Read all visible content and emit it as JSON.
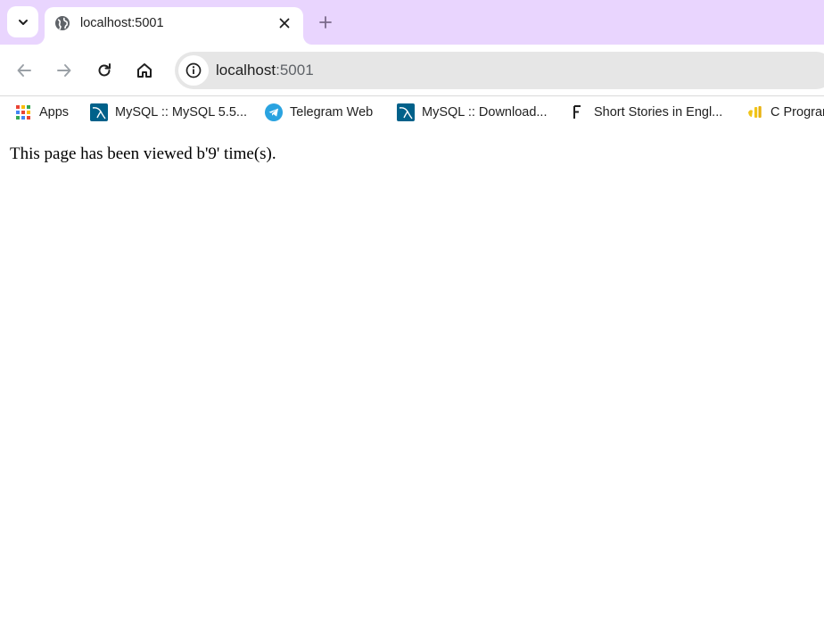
{
  "browser": {
    "tab": {
      "title": "localhost:5001"
    },
    "omnibox": {
      "host": "localhost",
      "port": ":5001"
    }
  },
  "bookmarks": [
    {
      "label": "Apps",
      "icon": "apps-grid-icon"
    },
    {
      "label": "MySQL :: MySQL 5.5...",
      "icon": "mysql-icon"
    },
    {
      "label": "Telegram Web",
      "icon": "telegram-icon"
    },
    {
      "label": "MySQL :: Download...",
      "icon": "mysql-icon"
    },
    {
      "label": "Short Stories in Engl...",
      "icon": "f-letter-icon"
    },
    {
      "label": "C Program",
      "icon": "js-logo-icon"
    }
  ],
  "page": {
    "message": "This page has been viewed b'9' time(s)."
  },
  "colors": {
    "tabstrip_bg": "#e9d5fe",
    "omnibox_bg": "#e6e6e6",
    "mysql_blue": "#00618a",
    "telegram_blue": "#2aa3e0"
  }
}
